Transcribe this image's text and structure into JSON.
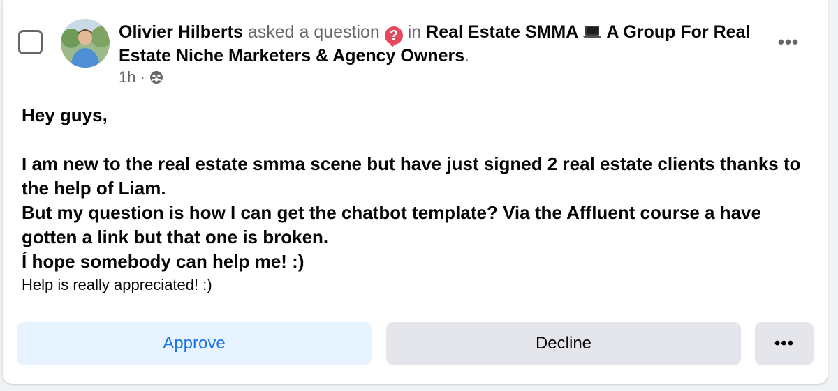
{
  "post": {
    "author": "Olivier Hilberts",
    "action": "asked a question",
    "in_word": "in",
    "group_part1": "Real Estate SMMA",
    "group_part2": "A Group For Real Estate Niche Marketers & Agency Owners",
    "period": ".",
    "time": "1h",
    "separator": "·",
    "body_lines": [
      "Hey guys,",
      "I am new to the real estate smma scene but have just signed 2 real estate clients thanks to the help of Liam.",
      "But my question is how I can get the chatbot template? Via the Affluent course a have gotten a link but that one is broken.",
      "Í hope somebody can help me! :)",
      "Help is really appreciated! :)"
    ],
    "question_glyph": "?",
    "more_glyph": "•••"
  },
  "actions": {
    "approve": "Approve",
    "decline": "Decline",
    "more": "•••"
  },
  "icons": {
    "checkbox": "checkbox-empty",
    "question": "question-bubble-icon",
    "laptop": "laptop-icon",
    "privacy": "people-group-icon",
    "more": "ellipsis-icon"
  },
  "colors": {
    "approve_bg": "#e7f3ff",
    "approve_text": "#1b74e4",
    "decline_bg": "#e4e6eb",
    "question_icon": "#e4495e"
  }
}
